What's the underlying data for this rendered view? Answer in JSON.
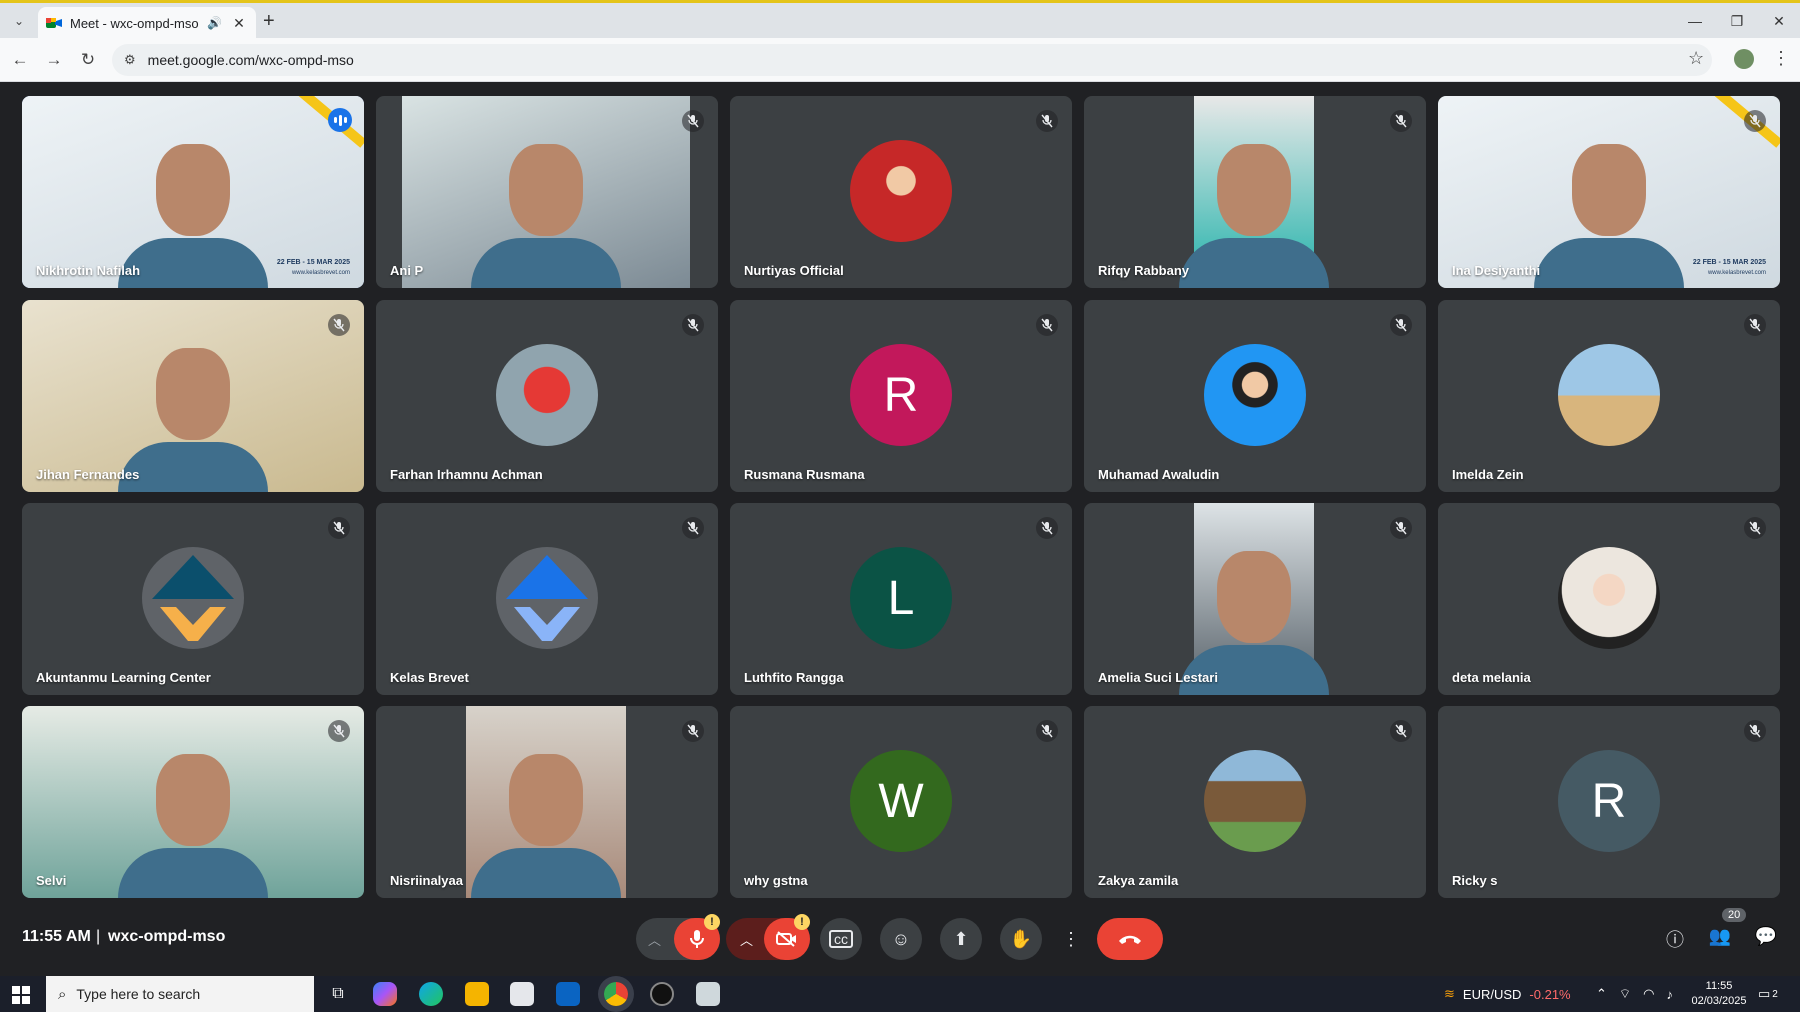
{
  "browser": {
    "tab_title": "Meet - wxc-ompd-mso",
    "url": "meet.google.com/wxc-ompd-mso"
  },
  "participants": [
    {
      "name": "Nikhrotin Nafilah",
      "state": "speaking",
      "kind": "video"
    },
    {
      "name": "Ani P",
      "state": "muted",
      "kind": "video"
    },
    {
      "name": "Nurtiyas Official",
      "state": "muted",
      "kind": "avatar-photo"
    },
    {
      "name": "Rifqy Rabbany",
      "state": "muted",
      "kind": "video"
    },
    {
      "name": "Ina Desiyanthi",
      "state": "muted",
      "kind": "video"
    },
    {
      "name": "Jihan Fernandes",
      "state": "muted",
      "kind": "video"
    },
    {
      "name": "Farhan Irhamnu Achman",
      "state": "muted",
      "kind": "avatar-photo"
    },
    {
      "name": "Rusmana Rusmana",
      "state": "muted",
      "kind": "avatar-letter",
      "letter": "R",
      "color": "#c2185b"
    },
    {
      "name": "Muhamad Awaludin",
      "state": "muted",
      "kind": "avatar-photo"
    },
    {
      "name": "Imelda Zein",
      "state": "muted",
      "kind": "avatar-photo"
    },
    {
      "name": "Akuntanmu Learning Center",
      "state": "muted",
      "kind": "avatar-logo"
    },
    {
      "name": "Kelas Brevet",
      "state": "muted",
      "kind": "avatar-logo"
    },
    {
      "name": "Luthfito Rangga",
      "state": "muted",
      "kind": "avatar-letter",
      "letter": "L",
      "color": "#0b5345"
    },
    {
      "name": "Amelia Suci Lestari",
      "state": "muted",
      "kind": "video"
    },
    {
      "name": "deta melania",
      "state": "muted",
      "kind": "avatar-photo"
    },
    {
      "name": "Selvi",
      "state": "muted",
      "kind": "video"
    },
    {
      "name": "Nisriinalyaa",
      "state": "muted",
      "kind": "video"
    },
    {
      "name": "why gstna",
      "state": "muted",
      "kind": "avatar-letter",
      "letter": "W",
      "color": "#33691e"
    },
    {
      "name": "Zakya zamila",
      "state": "muted",
      "kind": "avatar-photo"
    },
    {
      "name": "Ricky s",
      "state": "muted",
      "kind": "avatar-letter",
      "letter": "R",
      "color": "#455a64"
    }
  ],
  "slide_text": {
    "date_range": "22 FEB - 15 MAR 2025",
    "website": "www.kelasbrevet.com"
  },
  "meeting": {
    "time": "11:55 AM",
    "separator": "|",
    "code": "wxc-ompd-mso",
    "participant_count": "20",
    "warning_glyph": "!"
  },
  "taskbar": {
    "search_placeholder": "Type here to search",
    "ticker_pair": "EUR/USD",
    "ticker_change": "-0.21%",
    "clock_time": "11:55",
    "clock_date": "02/03/2025",
    "notif_count": "2"
  },
  "colors": {
    "speaking_outline": "#8ab4f8",
    "leave_button": "#ea4335",
    "tile_bg": "#3c4043"
  }
}
